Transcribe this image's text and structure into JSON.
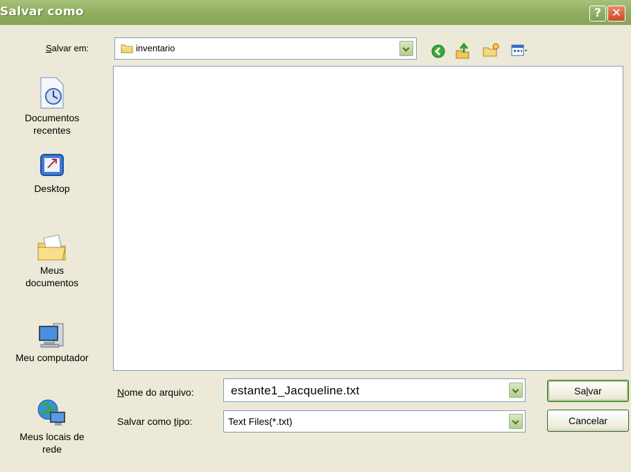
{
  "window": {
    "title": "Salvar como"
  },
  "save_in": {
    "label_prefix": "",
    "label_accel": "S",
    "label_rest": "alvar em:",
    "folder": "inventario"
  },
  "places": [
    {
      "line1": "Documentos",
      "line2": "recentes",
      "icon": "recent-documents-icon"
    },
    {
      "line1": "Desktop",
      "line2": "",
      "icon": "desktop-icon"
    },
    {
      "line1": "Meus",
      "line2": "documentos",
      "icon": "my-documents-icon"
    },
    {
      "line1": "Meu computador",
      "line2": "",
      "icon": "my-computer-icon"
    },
    {
      "line1": "Meus locais de",
      "line2": "rede",
      "icon": "network-places-icon"
    }
  ],
  "file_name": {
    "label_accel": "N",
    "label_rest": "ome do arquivo:",
    "value": "estante1_Jacqueline.txt"
  },
  "file_type": {
    "label_prefix": "Salvar como ",
    "label_accel": "t",
    "label_rest": "ipo:",
    "value": "Text Files(*.txt)"
  },
  "buttons": {
    "save_prefix": "Sa",
    "save_accel": "l",
    "save_rest": "var",
    "cancel": "Cancelar"
  },
  "colors": {
    "titlebar": "#93b062",
    "list_bg": "#ffffff",
    "dialog_bg": "#ece9d8"
  }
}
